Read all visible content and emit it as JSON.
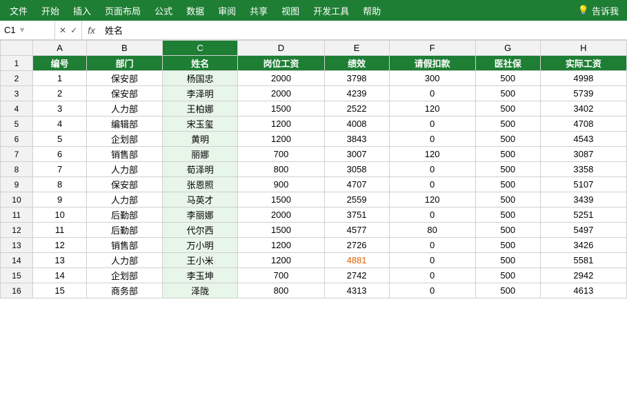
{
  "menubar": {
    "items": [
      "文件",
      "开始",
      "插入",
      "页面布局",
      "公式",
      "数据",
      "审阅",
      "共享",
      "视图",
      "开发工具",
      "帮助"
    ],
    "tell": "告诉我",
    "lightbulb": "💡"
  },
  "formulabar": {
    "cellref": "C1",
    "formula_text": "姓名",
    "fx": "fx",
    "cross": "✕",
    "check": "✓"
  },
  "columns": {
    "row_num_header": "",
    "headers": [
      "A",
      "B",
      "C",
      "D",
      "E",
      "F",
      "G",
      "H"
    ]
  },
  "header_row": {
    "row_num": "1",
    "cells": [
      "编号",
      "部门",
      "姓名",
      "岗位工资",
      "绩效",
      "请假扣款",
      "医社保",
      "实际工资"
    ]
  },
  "rows": [
    {
      "num": "2",
      "cells": [
        "1",
        "保安部",
        "杨国忠",
        "2000",
        "3798",
        "300",
        "500",
        "4998"
      ],
      "orange": []
    },
    {
      "num": "3",
      "cells": [
        "2",
        "保安部",
        "李泽明",
        "2000",
        "4239",
        "0",
        "500",
        "5739"
      ],
      "orange": []
    },
    {
      "num": "4",
      "cells": [
        "3",
        "人力部",
        "王柏娜",
        "1500",
        "2522",
        "120",
        "500",
        "3402"
      ],
      "orange": []
    },
    {
      "num": "5",
      "cells": [
        "4",
        "编辑部",
        "宋玉玺",
        "1200",
        "4008",
        "0",
        "500",
        "4708"
      ],
      "orange": []
    },
    {
      "num": "6",
      "cells": [
        "5",
        "企划部",
        "黄明",
        "1200",
        "3843",
        "0",
        "500",
        "4543"
      ],
      "orange": []
    },
    {
      "num": "7",
      "cells": [
        "6",
        "销售部",
        "丽娜",
        "700",
        "3007",
        "120",
        "500",
        "3087"
      ],
      "orange": []
    },
    {
      "num": "8",
      "cells": [
        "7",
        "人力部",
        "荀泽明",
        "800",
        "3058",
        "0",
        "500",
        "3358"
      ],
      "orange": []
    },
    {
      "num": "9",
      "cells": [
        "8",
        "保安部",
        "张恩照",
        "900",
        "4707",
        "0",
        "500",
        "5107"
      ],
      "orange": []
    },
    {
      "num": "10",
      "cells": [
        "9",
        "人力部",
        "马英才",
        "1500",
        "2559",
        "120",
        "500",
        "3439"
      ],
      "orange": []
    },
    {
      "num": "11",
      "cells": [
        "10",
        "后勤部",
        "李丽娜",
        "2000",
        "3751",
        "0",
        "500",
        "5251"
      ],
      "orange": []
    },
    {
      "num": "12",
      "cells": [
        "11",
        "后勤部",
        "代尔西",
        "1500",
        "4577",
        "80",
        "500",
        "5497"
      ],
      "orange": []
    },
    {
      "num": "13",
      "cells": [
        "12",
        "销售部",
        "万小明",
        "1200",
        "2726",
        "0",
        "500",
        "3426"
      ],
      "orange": []
    },
    {
      "num": "14",
      "cells": [
        "13",
        "人力部",
        "王小米",
        "1200",
        "4881",
        "0",
        "500",
        "5581"
      ],
      "orange": [
        4
      ]
    },
    {
      "num": "15",
      "cells": [
        "14",
        "企划部",
        "李玉坤",
        "700",
        "2742",
        "0",
        "500",
        "2942"
      ],
      "orange": []
    },
    {
      "num": "16",
      "cells": [
        "15",
        "商务部",
        "泽陇",
        "800",
        "4313",
        "0",
        "500",
        "4613"
      ],
      "orange": []
    }
  ]
}
